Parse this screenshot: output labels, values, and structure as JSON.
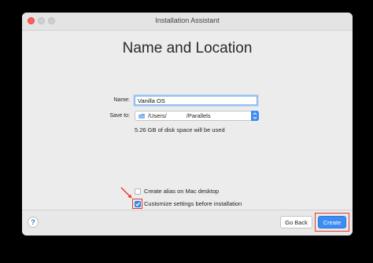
{
  "window": {
    "title": "Installation Assistant"
  },
  "main": {
    "heading": "Name and Location"
  },
  "form": {
    "name_label": "Name:",
    "name_value": "Vanilla OS",
    "save_label": "Save to:",
    "save_path": "/Users/            /Parallels",
    "disk_info": "5.26 GB of disk space will be used"
  },
  "options": {
    "alias_label": "Create alias on Mac desktop",
    "alias_checked": false,
    "customize_label": "Customize settings before installation",
    "customize_checked": true
  },
  "footer": {
    "help_label": "?",
    "back_label": "Go Back",
    "create_label": "Create"
  },
  "colors": {
    "accent": "#3b8cf3",
    "annotation": "#e23b2e",
    "close": "#fe5f57"
  }
}
